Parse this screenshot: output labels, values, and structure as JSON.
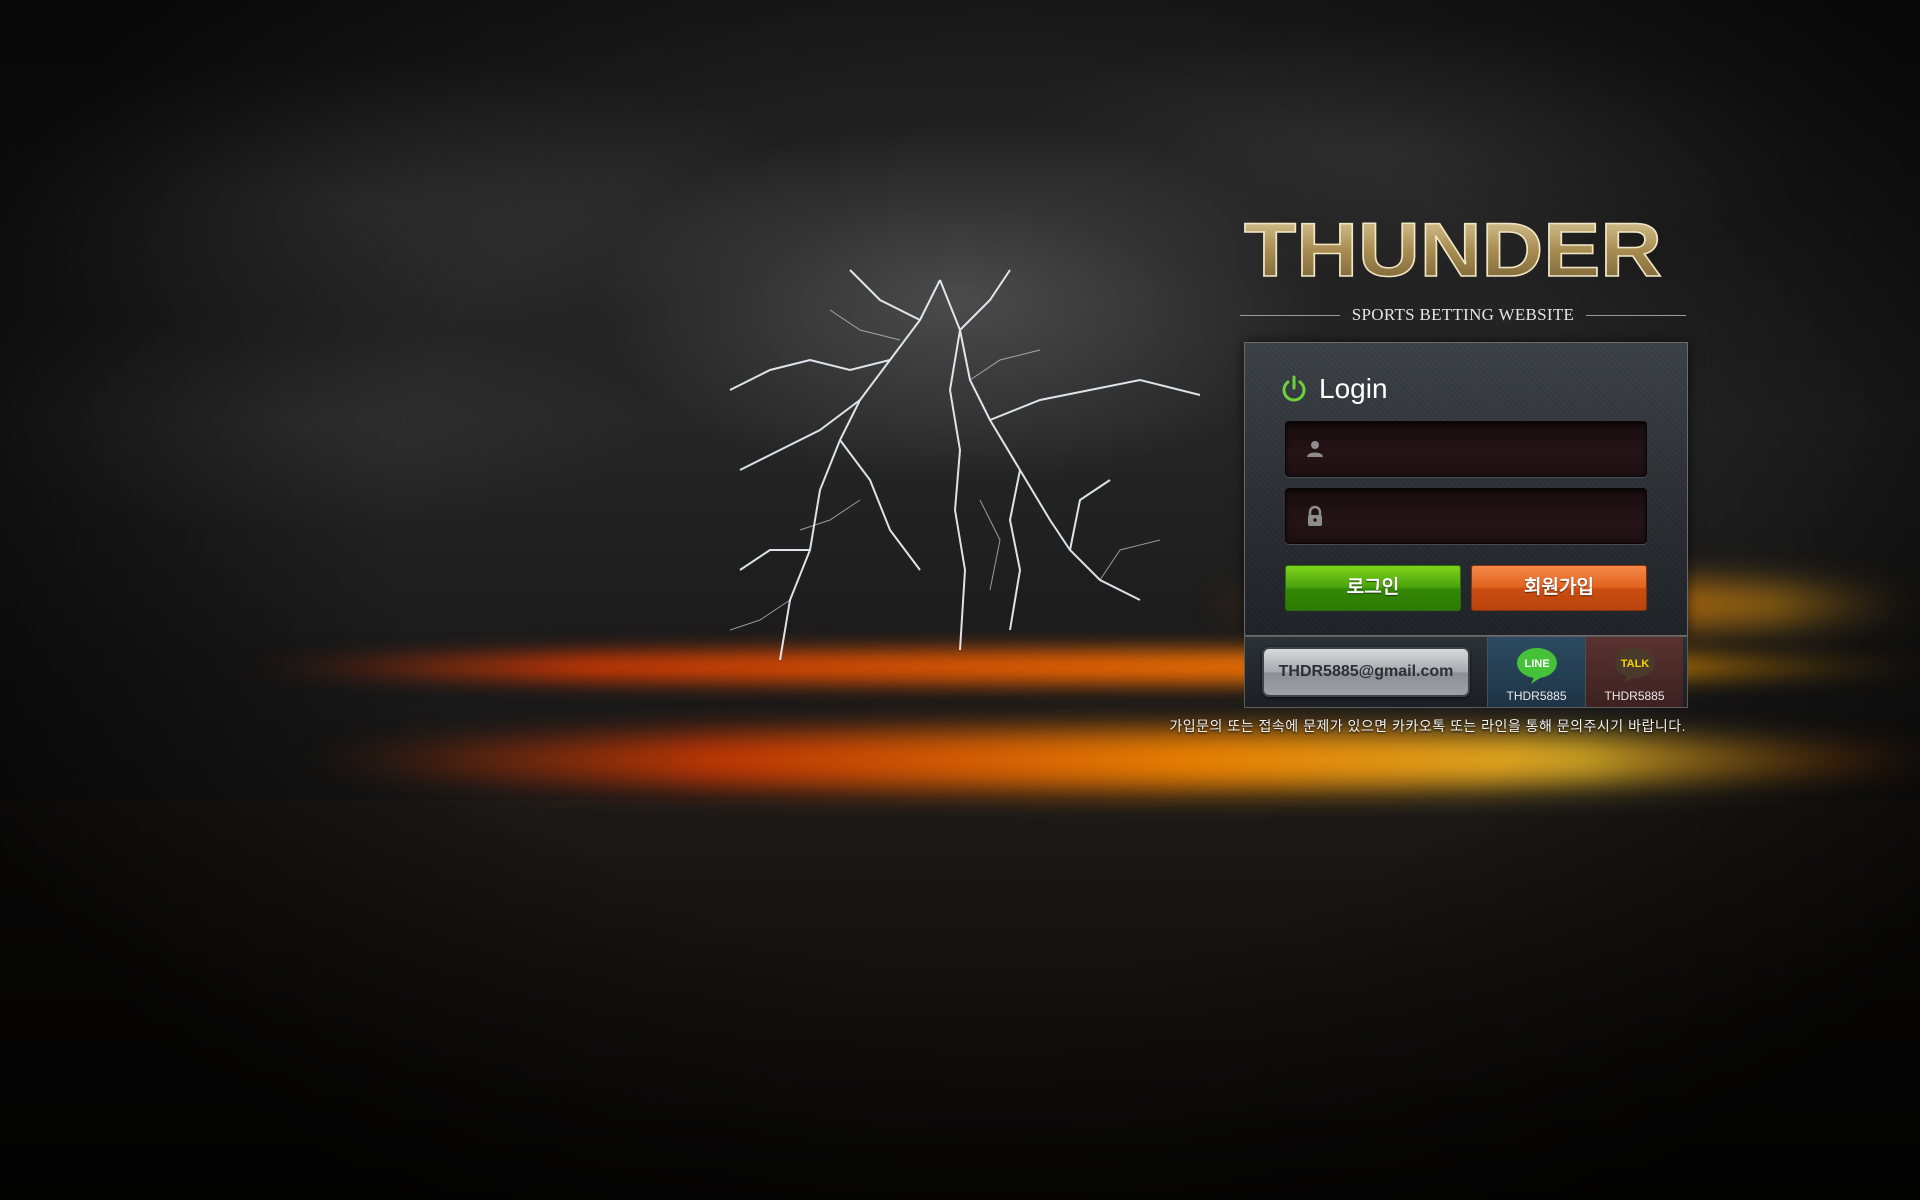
{
  "brand": {
    "name": "THUNDER",
    "tagline": "SPORTS BETTING WEBSITE"
  },
  "login": {
    "title": "Login",
    "username_placeholder": "",
    "password_placeholder": "",
    "login_button": "로그인",
    "join_button": "회원가입"
  },
  "contact": {
    "email": "THDR5885@gmail.com",
    "line_label": "LINE",
    "line_id": "THDR5885",
    "talk_label": "TALK",
    "talk_id": "THDR5885"
  },
  "notice": "가입문의 또는 접속에 문제가 있으면 카카오톡 또는 라인을 통해 문의주시기 바랍니다.",
  "colors": {
    "login_button": "#4aa30b",
    "join_button": "#e2621f",
    "logo_gold": "#b9a06a",
    "power_icon": "#6fd13a"
  },
  "icons": {
    "user_field": "user-icon",
    "password_field": "lock-icon",
    "login_heading": "power-icon",
    "line": "line-chat-icon",
    "talk": "kakaotalk-icon"
  }
}
